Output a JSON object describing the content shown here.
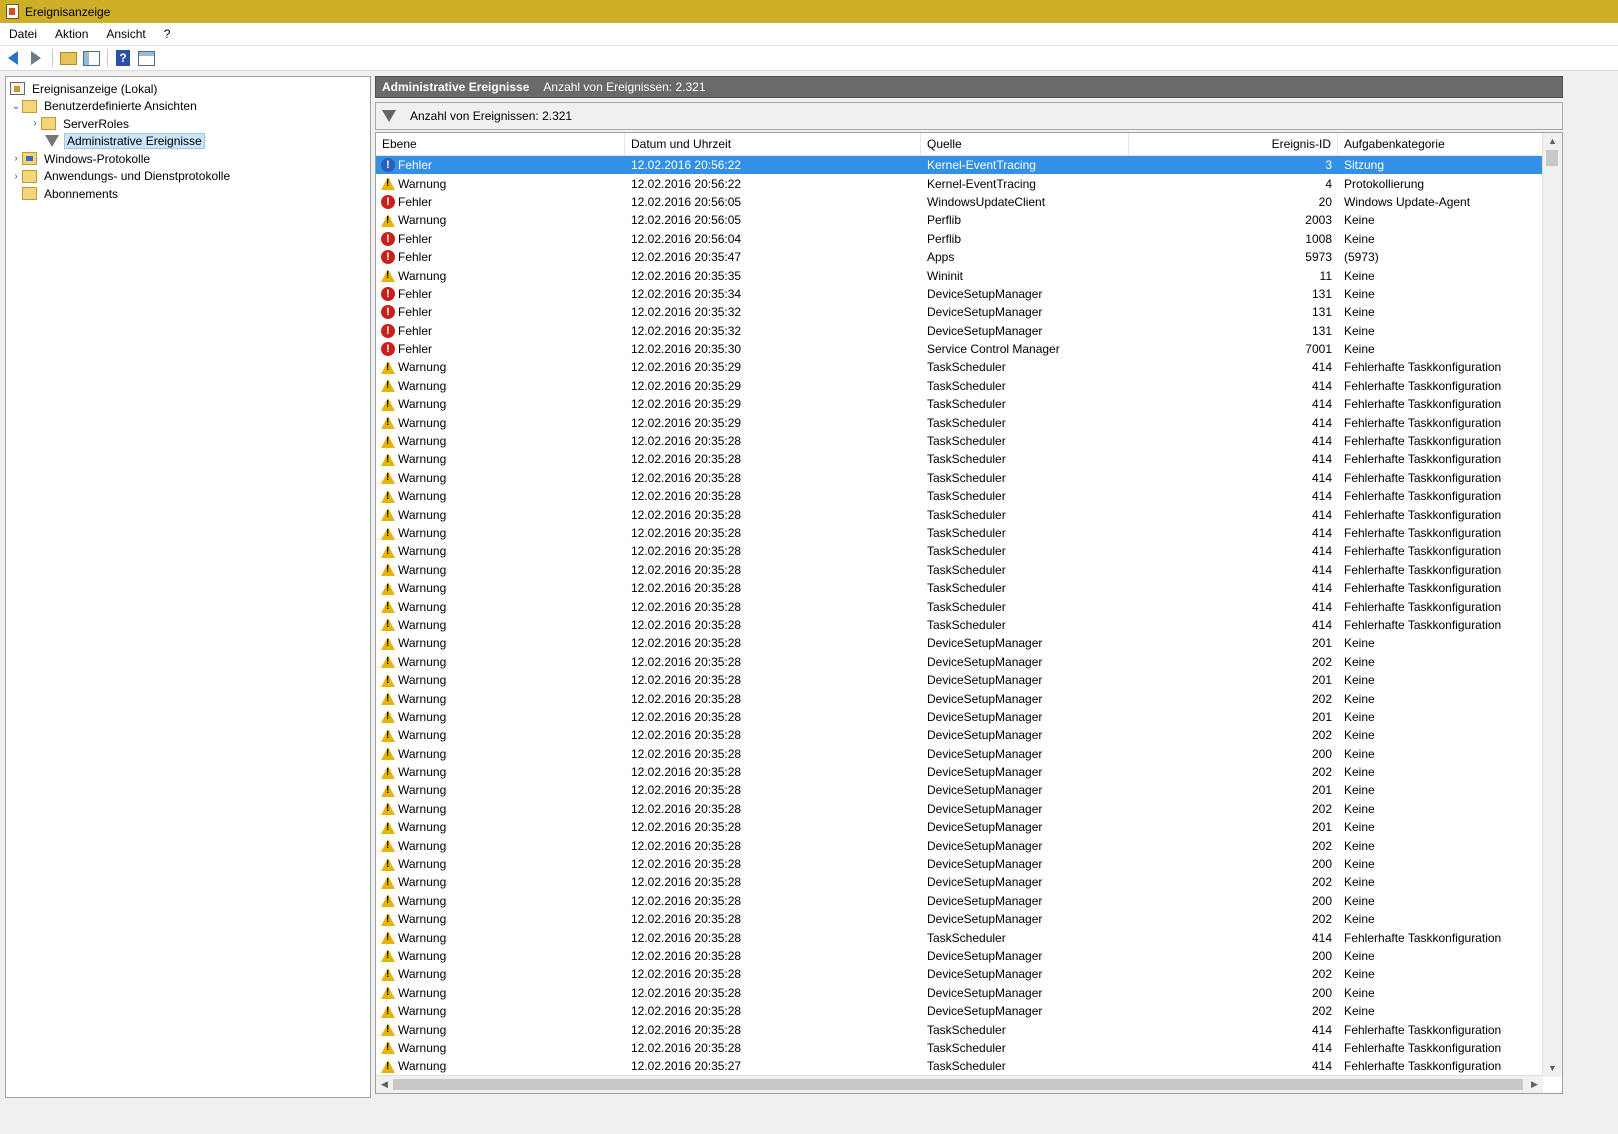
{
  "window": {
    "title": "Ereignisanzeige"
  },
  "menu": [
    "Datei",
    "Aktion",
    "Ansicht",
    "?"
  ],
  "toolbar": [
    "back-arrow-icon",
    "forward-arrow-icon",
    "up-folder-icon",
    "show-hide-tree-icon",
    "help-icon",
    "show-hide-action-pane-icon"
  ],
  "tree": {
    "root": "Ereignisanzeige (Lokal)",
    "custom_views": "Benutzerdefinierte Ansichten",
    "server_roles": "ServerRoles",
    "admin_events": "Administrative Ereignisse",
    "windows_logs": "Windows-Protokolle",
    "app_service_logs": "Anwendungs- und Dienstprotokolle",
    "subscriptions": "Abonnements"
  },
  "pane": {
    "title": "Administrative Ereignisse",
    "count": "Anzahl von Ereignissen: 2.321",
    "filter_text": "Anzahl von Ereignissen: 2.321"
  },
  "columns": [
    "Ebene",
    "Datum und Uhrzeit",
    "Quelle",
    "Ereignis-ID",
    "Aufgabenkategorie"
  ],
  "colors": {
    "title_bar": "#cdb028",
    "selection": "#3390e4",
    "header_bar": "#6a6a6a",
    "error": "#c8201a",
    "warning": "#e5b50a"
  },
  "events": [
    {
      "level": "Fehler",
      "date": "12.02.2016 20:56:22",
      "source": "Kernel-EventTracing",
      "id": "3",
      "category": "Sitzung",
      "selected": true
    },
    {
      "level": "Warnung",
      "date": "12.02.2016 20:56:22",
      "source": "Kernel-EventTracing",
      "id": "4",
      "category": "Protokollierung"
    },
    {
      "level": "Fehler",
      "date": "12.02.2016 20:56:05",
      "source": "WindowsUpdateClient",
      "id": "20",
      "category": "Windows Update-Agent"
    },
    {
      "level": "Warnung",
      "date": "12.02.2016 20:56:05",
      "source": "Perflib",
      "id": "2003",
      "category": "Keine"
    },
    {
      "level": "Fehler",
      "date": "12.02.2016 20:56:04",
      "source": "Perflib",
      "id": "1008",
      "category": "Keine"
    },
    {
      "level": "Fehler",
      "date": "12.02.2016 20:35:47",
      "source": "Apps",
      "id": "5973",
      "category": "(5973)"
    },
    {
      "level": "Warnung",
      "date": "12.02.2016 20:35:35",
      "source": "Wininit",
      "id": "11",
      "category": "Keine"
    },
    {
      "level": "Fehler",
      "date": "12.02.2016 20:35:34",
      "source": "DeviceSetupManager",
      "id": "131",
      "category": "Keine"
    },
    {
      "level": "Fehler",
      "date": "12.02.2016 20:35:32",
      "source": "DeviceSetupManager",
      "id": "131",
      "category": "Keine"
    },
    {
      "level": "Fehler",
      "date": "12.02.2016 20:35:32",
      "source": "DeviceSetupManager",
      "id": "131",
      "category": "Keine"
    },
    {
      "level": "Fehler",
      "date": "12.02.2016 20:35:30",
      "source": "Service Control Manager",
      "id": "7001",
      "category": "Keine"
    },
    {
      "level": "Warnung",
      "date": "12.02.2016 20:35:29",
      "source": "TaskScheduler",
      "id": "414",
      "category": "Fehlerhafte Taskkonfiguration"
    },
    {
      "level": "Warnung",
      "date": "12.02.2016 20:35:29",
      "source": "TaskScheduler",
      "id": "414",
      "category": "Fehlerhafte Taskkonfiguration"
    },
    {
      "level": "Warnung",
      "date": "12.02.2016 20:35:29",
      "source": "TaskScheduler",
      "id": "414",
      "category": "Fehlerhafte Taskkonfiguration"
    },
    {
      "level": "Warnung",
      "date": "12.02.2016 20:35:29",
      "source": "TaskScheduler",
      "id": "414",
      "category": "Fehlerhafte Taskkonfiguration"
    },
    {
      "level": "Warnung",
      "date": "12.02.2016 20:35:28",
      "source": "TaskScheduler",
      "id": "414",
      "category": "Fehlerhafte Taskkonfiguration"
    },
    {
      "level": "Warnung",
      "date": "12.02.2016 20:35:28",
      "source": "TaskScheduler",
      "id": "414",
      "category": "Fehlerhafte Taskkonfiguration"
    },
    {
      "level": "Warnung",
      "date": "12.02.2016 20:35:28",
      "source": "TaskScheduler",
      "id": "414",
      "category": "Fehlerhafte Taskkonfiguration"
    },
    {
      "level": "Warnung",
      "date": "12.02.2016 20:35:28",
      "source": "TaskScheduler",
      "id": "414",
      "category": "Fehlerhafte Taskkonfiguration"
    },
    {
      "level": "Warnung",
      "date": "12.02.2016 20:35:28",
      "source": "TaskScheduler",
      "id": "414",
      "category": "Fehlerhafte Taskkonfiguration"
    },
    {
      "level": "Warnung",
      "date": "12.02.2016 20:35:28",
      "source": "TaskScheduler",
      "id": "414",
      "category": "Fehlerhafte Taskkonfiguration"
    },
    {
      "level": "Warnung",
      "date": "12.02.2016 20:35:28",
      "source": "TaskScheduler",
      "id": "414",
      "category": "Fehlerhafte Taskkonfiguration"
    },
    {
      "level": "Warnung",
      "date": "12.02.2016 20:35:28",
      "source": "TaskScheduler",
      "id": "414",
      "category": "Fehlerhafte Taskkonfiguration"
    },
    {
      "level": "Warnung",
      "date": "12.02.2016 20:35:28",
      "source": "TaskScheduler",
      "id": "414",
      "category": "Fehlerhafte Taskkonfiguration"
    },
    {
      "level": "Warnung",
      "date": "12.02.2016 20:35:28",
      "source": "TaskScheduler",
      "id": "414",
      "category": "Fehlerhafte Taskkonfiguration"
    },
    {
      "level": "Warnung",
      "date": "12.02.2016 20:35:28",
      "source": "TaskScheduler",
      "id": "414",
      "category": "Fehlerhafte Taskkonfiguration"
    },
    {
      "level": "Warnung",
      "date": "12.02.2016 20:35:28",
      "source": "DeviceSetupManager",
      "id": "201",
      "category": "Keine"
    },
    {
      "level": "Warnung",
      "date": "12.02.2016 20:35:28",
      "source": "DeviceSetupManager",
      "id": "202",
      "category": "Keine"
    },
    {
      "level": "Warnung",
      "date": "12.02.2016 20:35:28",
      "source": "DeviceSetupManager",
      "id": "201",
      "category": "Keine"
    },
    {
      "level": "Warnung",
      "date": "12.02.2016 20:35:28",
      "source": "DeviceSetupManager",
      "id": "202",
      "category": "Keine"
    },
    {
      "level": "Warnung",
      "date": "12.02.2016 20:35:28",
      "source": "DeviceSetupManager",
      "id": "201",
      "category": "Keine"
    },
    {
      "level": "Warnung",
      "date": "12.02.2016 20:35:28",
      "source": "DeviceSetupManager",
      "id": "202",
      "category": "Keine"
    },
    {
      "level": "Warnung",
      "date": "12.02.2016 20:35:28",
      "source": "DeviceSetupManager",
      "id": "200",
      "category": "Keine"
    },
    {
      "level": "Warnung",
      "date": "12.02.2016 20:35:28",
      "source": "DeviceSetupManager",
      "id": "202",
      "category": "Keine"
    },
    {
      "level": "Warnung",
      "date": "12.02.2016 20:35:28",
      "source": "DeviceSetupManager",
      "id": "201",
      "category": "Keine"
    },
    {
      "level": "Warnung",
      "date": "12.02.2016 20:35:28",
      "source": "DeviceSetupManager",
      "id": "202",
      "category": "Keine"
    },
    {
      "level": "Warnung",
      "date": "12.02.2016 20:35:28",
      "source": "DeviceSetupManager",
      "id": "201",
      "category": "Keine"
    },
    {
      "level": "Warnung",
      "date": "12.02.2016 20:35:28",
      "source": "DeviceSetupManager",
      "id": "202",
      "category": "Keine"
    },
    {
      "level": "Warnung",
      "date": "12.02.2016 20:35:28",
      "source": "DeviceSetupManager",
      "id": "200",
      "category": "Keine"
    },
    {
      "level": "Warnung",
      "date": "12.02.2016 20:35:28",
      "source": "DeviceSetupManager",
      "id": "202",
      "category": "Keine"
    },
    {
      "level": "Warnung",
      "date": "12.02.2016 20:35:28",
      "source": "DeviceSetupManager",
      "id": "200",
      "category": "Keine"
    },
    {
      "level": "Warnung",
      "date": "12.02.2016 20:35:28",
      "source": "DeviceSetupManager",
      "id": "202",
      "category": "Keine"
    },
    {
      "level": "Warnung",
      "date": "12.02.2016 20:35:28",
      "source": "TaskScheduler",
      "id": "414",
      "category": "Fehlerhafte Taskkonfiguration"
    },
    {
      "level": "Warnung",
      "date": "12.02.2016 20:35:28",
      "source": "DeviceSetupManager",
      "id": "200",
      "category": "Keine"
    },
    {
      "level": "Warnung",
      "date": "12.02.2016 20:35:28",
      "source": "DeviceSetupManager",
      "id": "202",
      "category": "Keine"
    },
    {
      "level": "Warnung",
      "date": "12.02.2016 20:35:28",
      "source": "DeviceSetupManager",
      "id": "200",
      "category": "Keine"
    },
    {
      "level": "Warnung",
      "date": "12.02.2016 20:35:28",
      "source": "DeviceSetupManager",
      "id": "202",
      "category": "Keine"
    },
    {
      "level": "Warnung",
      "date": "12.02.2016 20:35:28",
      "source": "TaskScheduler",
      "id": "414",
      "category": "Fehlerhafte Taskkonfiguration"
    },
    {
      "level": "Warnung",
      "date": "12.02.2016 20:35:28",
      "source": "TaskScheduler",
      "id": "414",
      "category": "Fehlerhafte Taskkonfiguration"
    },
    {
      "level": "Warnung",
      "date": "12.02.2016 20:35:27",
      "source": "TaskScheduler",
      "id": "414",
      "category": "Fehlerhafte Taskkonfiguration"
    }
  ]
}
